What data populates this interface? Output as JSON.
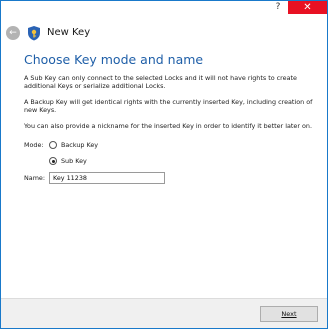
{
  "window": {
    "help_glyph": "?",
    "close_glyph": "✕"
  },
  "header": {
    "back_icon": "back-arrow-icon",
    "app_icon": "key-shield-icon",
    "title": "New Key"
  },
  "main": {
    "page_title": "Choose Key mode and name",
    "paragraphs": [
      "A Sub Key can only connect to the selected Locks and it will not have rights to create additional Keys or serialize additional Locks.",
      "A Backup Key will get identical rights with the currently inserted Key, including creation of new Keys.",
      "You can also provide a nickname for the inserted Key in order to identify it better later on."
    ],
    "mode_label": "Mode:",
    "mode_options": [
      {
        "label": "Backup Key",
        "selected": false
      },
      {
        "label": "Sub Key",
        "selected": true
      }
    ],
    "name_label": "Name:",
    "name_value": "Key 11238"
  },
  "footer": {
    "next_label": "Next"
  },
  "colors": {
    "accent": "#1f5fa8",
    "close": "#e81123",
    "border": "#1979ca"
  }
}
